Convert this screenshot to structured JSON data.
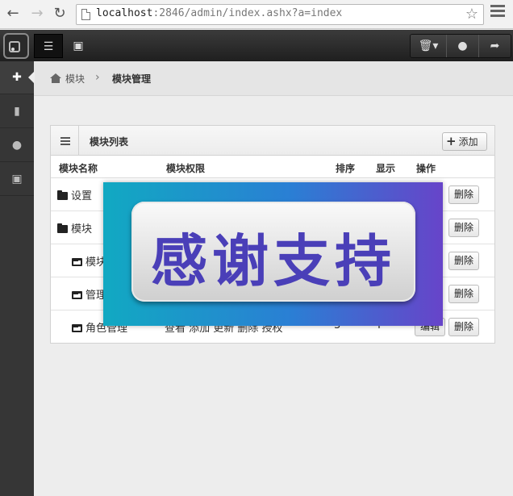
{
  "browser": {
    "url_host": "localhost",
    "url_rest": ":2846/admin/index.ashx?a=index"
  },
  "sidebar": {
    "items": [
      {
        "icon": "plus-icon"
      },
      {
        "icon": "bookmark-icon"
      },
      {
        "icon": "user-icon"
      },
      {
        "icon": "lock-icon"
      }
    ]
  },
  "breadcrumb": {
    "item1": "模块",
    "separator": "›",
    "item2": "模块管理"
  },
  "panel": {
    "title": "模块列表",
    "add_label": "添加",
    "columns": [
      "模块名称",
      "模块权限",
      "排序",
      "显示",
      "操作"
    ],
    "rows": [
      {
        "name": "设置",
        "delete": "删除"
      },
      {
        "name": "模块",
        "delete": "删除"
      },
      {
        "name": "模块",
        "delete": "删除"
      },
      {
        "name": "管理",
        "delete": "删除"
      },
      {
        "name": "角色管理",
        "perm": "查看 添加 更新 删除 授权",
        "order": "3",
        "show": "Y",
        "edit": "编辑",
        "delete": "删除"
      }
    ]
  },
  "overlay": {
    "text": "感谢支持"
  }
}
